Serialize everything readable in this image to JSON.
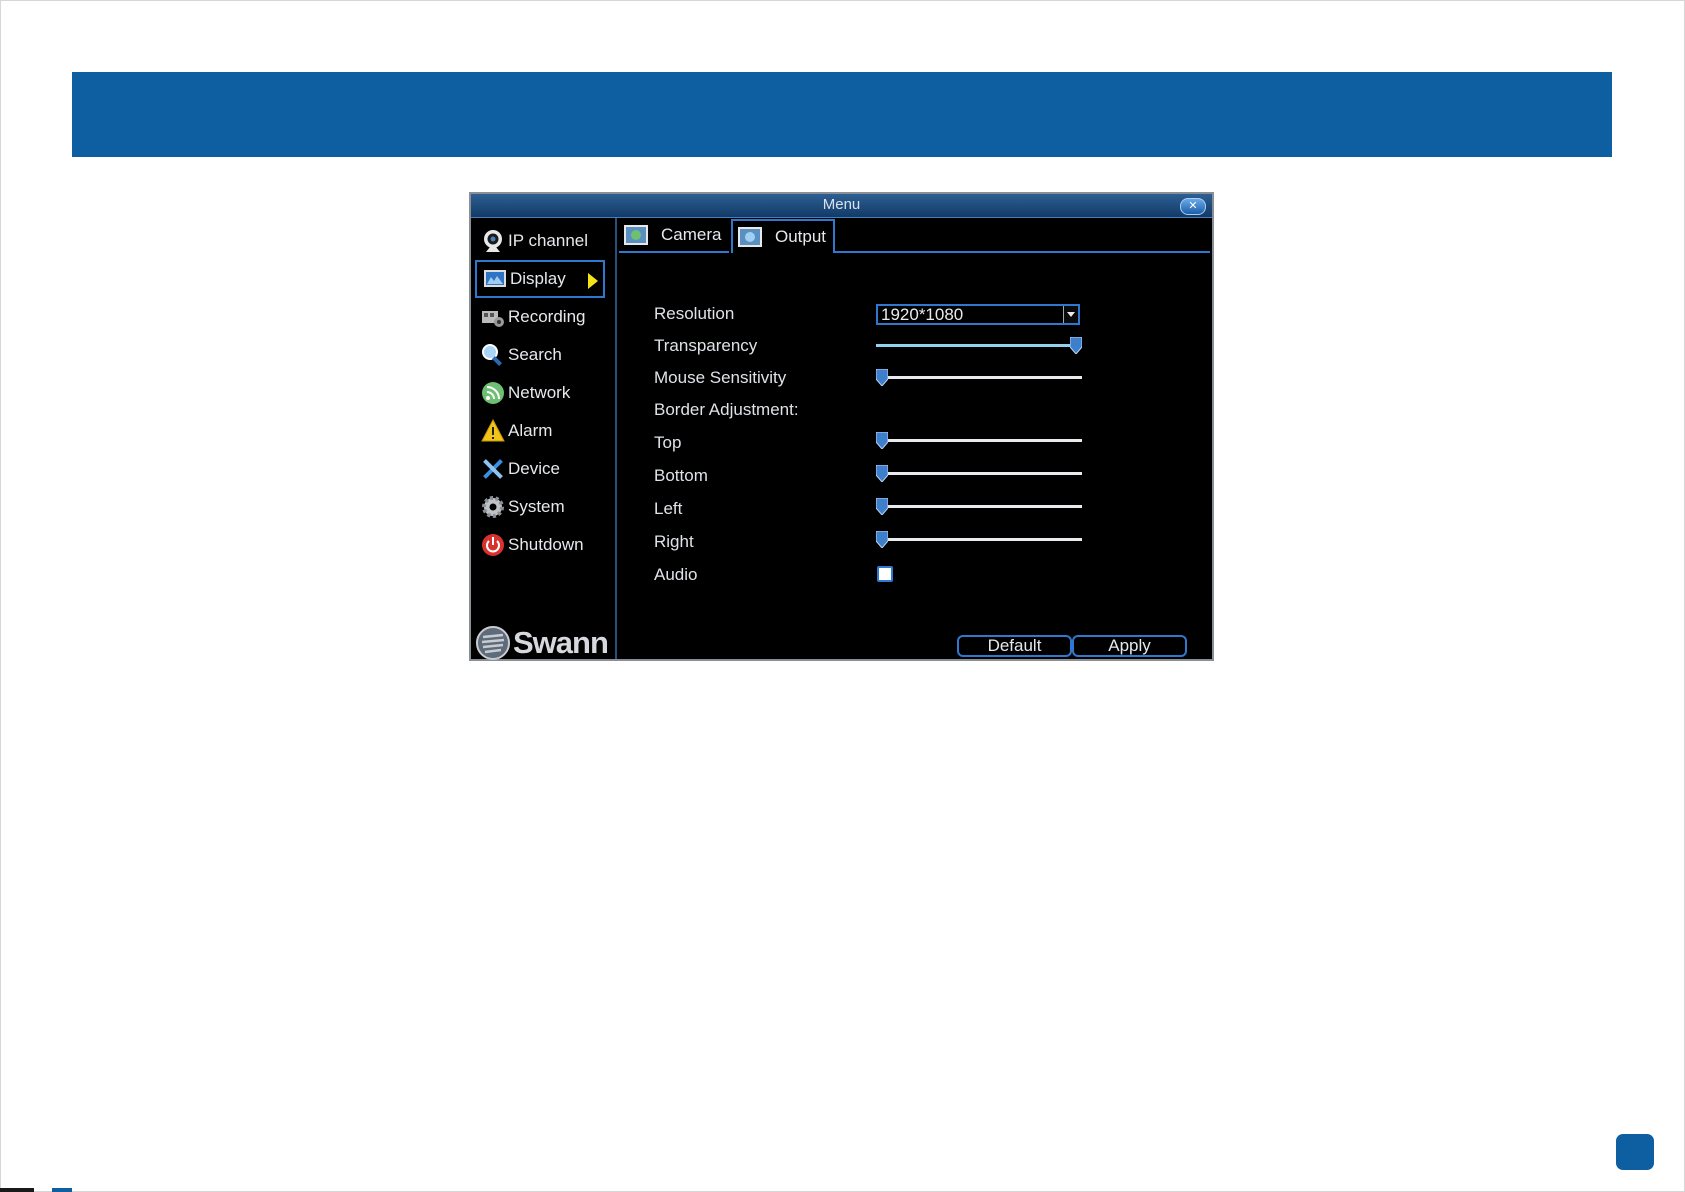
{
  "window": {
    "title": "Menu"
  },
  "sidebar": {
    "items": [
      {
        "label": "IP channel",
        "icon": "webcam-icon"
      },
      {
        "label": "Display",
        "icon": "monitor-icon",
        "active": true
      },
      {
        "label": "Recording",
        "icon": "film-icon"
      },
      {
        "label": "Search",
        "icon": "search-icon"
      },
      {
        "label": "Network",
        "icon": "network-icon"
      },
      {
        "label": "Alarm",
        "icon": "warning-icon"
      },
      {
        "label": "Device",
        "icon": "tools-icon"
      },
      {
        "label": "System",
        "icon": "gear-icon"
      },
      {
        "label": "Shutdown",
        "icon": "power-icon"
      }
    ],
    "logo": "Swann"
  },
  "tabs": [
    {
      "label": "Camera",
      "icon": "camera-settings-icon"
    },
    {
      "label": "Output",
      "icon": "output-settings-icon",
      "active": true
    }
  ],
  "form": {
    "resolution": {
      "label": "Resolution",
      "value": "1920*1080"
    },
    "transparency": {
      "label": "Transparency",
      "value": 1.0
    },
    "mouse_sensitivity": {
      "label": "Mouse Sensitivity",
      "value": 0.0
    },
    "border_adjustment": {
      "label": "Border Adjustment:"
    },
    "top": {
      "label": "Top",
      "value": 0.0
    },
    "bottom": {
      "label": "Bottom",
      "value": 0.0
    },
    "left": {
      "label": "Left",
      "value": 0.0
    },
    "right": {
      "label": "Right",
      "value": 0.0
    },
    "audio": {
      "label": "Audio",
      "checked": false
    }
  },
  "buttons": {
    "default": "Default",
    "apply": "Apply"
  },
  "colors": {
    "header_band": "#0d5fa2",
    "accent_border": "#2f78d0",
    "slider_fill": "#8fd3ee",
    "active_arrow": "#f3e41a"
  }
}
